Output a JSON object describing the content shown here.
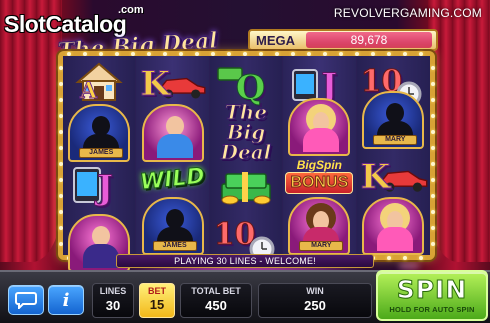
{
  "header": {
    "brand": "SlotCatalog",
    "brand_suffix": ".com",
    "site": "REVOLVERGAMING.COM",
    "logo": "The Big Deal"
  },
  "jackpot": {
    "label": "MEGA",
    "value": "89,678"
  },
  "reels": [
    [
      {
        "symbol": "house-icon"
      },
      {
        "symbol": "character-james",
        "name": "JAMES"
      },
      {
        "symbol": "tablet-icon",
        "letter": "J"
      },
      {
        "symbol": "character-james",
        "name": ""
      }
    ],
    [
      {
        "symbol": "card-k",
        "letter": "K"
      },
      {
        "symbol": "character-mary-fan"
      },
      {
        "symbol": "wild",
        "text": "WILD"
      },
      {
        "symbol": "character-james",
        "name": "JAMES"
      }
    ],
    [
      {
        "symbol": "card-q",
        "letter": "Q"
      },
      {
        "symbol": "big-deal-logo",
        "text": "The Big Deal"
      },
      {
        "symbol": "cash-stack-icon"
      },
      {
        "symbol": "card-10",
        "letter": "10"
      }
    ],
    [
      {
        "symbol": "card-j",
        "letter": "J"
      },
      {
        "symbol": "character-blonde"
      },
      {
        "symbol": "bonus",
        "top": "BigSpin",
        "text": "BONUS"
      },
      {
        "symbol": "character-mary",
        "name": "MARY"
      }
    ],
    [
      {
        "symbol": "card-10",
        "letter": "10"
      },
      {
        "symbol": "character-mary",
        "name": "MARY"
      },
      {
        "symbol": "card-k",
        "letter": "K"
      },
      {
        "symbol": "character-blonde"
      }
    ]
  ],
  "message": "PLAYING 30 LINES - WELCOME!",
  "controls": {
    "chat_icon": "chat-bubble-icon",
    "info_label": "i",
    "lines_label": "LINES",
    "lines_value": "30",
    "bet_label": "BET",
    "bet_value": "15",
    "total_bet_label": "TOTAL BET",
    "total_bet_value": "450",
    "win_label": "WIN",
    "win_value": "250",
    "spin_label": "SPIN",
    "spin_hint": "HOLD FOR AUTO SPIN"
  },
  "colors": {
    "frame": "#d8a235",
    "spin_button": "#5fbf22",
    "bet_button": "#f2c42a",
    "info_button": "#2a7ae0",
    "jackpot_bar": "#e04a72"
  }
}
